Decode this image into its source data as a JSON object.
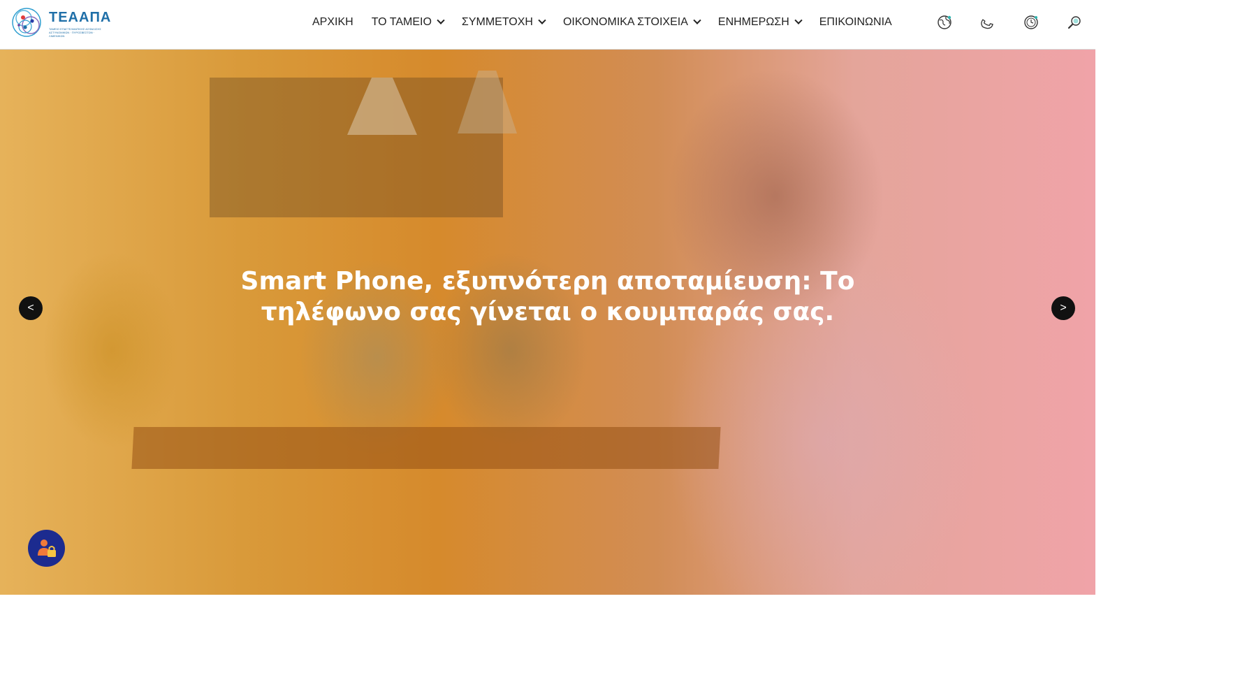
{
  "logo": {
    "name": "ΤΕΑΑΠΑ",
    "subtitle": "ΤΑΜΕΙΟ ΕΠΑΓΓΕΛΜΑΤΙΚΗΣ ΑΣΦΑΛΙΣΗΣ ΑΣΤΥΝΟΜΙΚΩΝ · ΠΥΡΟΣΒΕΣΤΩΝ · ΛΙΜΕΝΙΚΩΝ"
  },
  "nav": {
    "items": [
      {
        "label": "ΑΡΧΙΚΗ",
        "has_dropdown": false
      },
      {
        "label": "ΤΟ ΤΑΜΕΙΟ",
        "has_dropdown": true
      },
      {
        "label": "ΣΥΜΜΕΤΟΧΗ",
        "has_dropdown": true
      },
      {
        "label": "ΟΙΚΟΝΟΜΙΚΑ ΣΤΟΙΧΕΙΑ",
        "has_dropdown": true
      },
      {
        "label": "ΕΝΗΜΕΡΩΣΗ",
        "has_dropdown": true
      },
      {
        "label": "ΕΠΙΚΟΙΝΩΝΙΑ",
        "has_dropdown": false
      }
    ]
  },
  "tools": {
    "icons": [
      "globe-icon",
      "phone-icon",
      "clock-icon",
      "search-icon"
    ]
  },
  "hero": {
    "headline": "Smart Phone, εξυπνότερη αποταμίευση: Το τηλέφωνο σας γίνεται ο κουμπαράς σας.",
    "prev_label": "<",
    "next_label": ">"
  },
  "colors": {
    "accent": "#1c2b8f",
    "logo_blue": "#1f6fa8",
    "overlay_left": "#e6b25a",
    "overlay_right": "#f0a3a8"
  }
}
